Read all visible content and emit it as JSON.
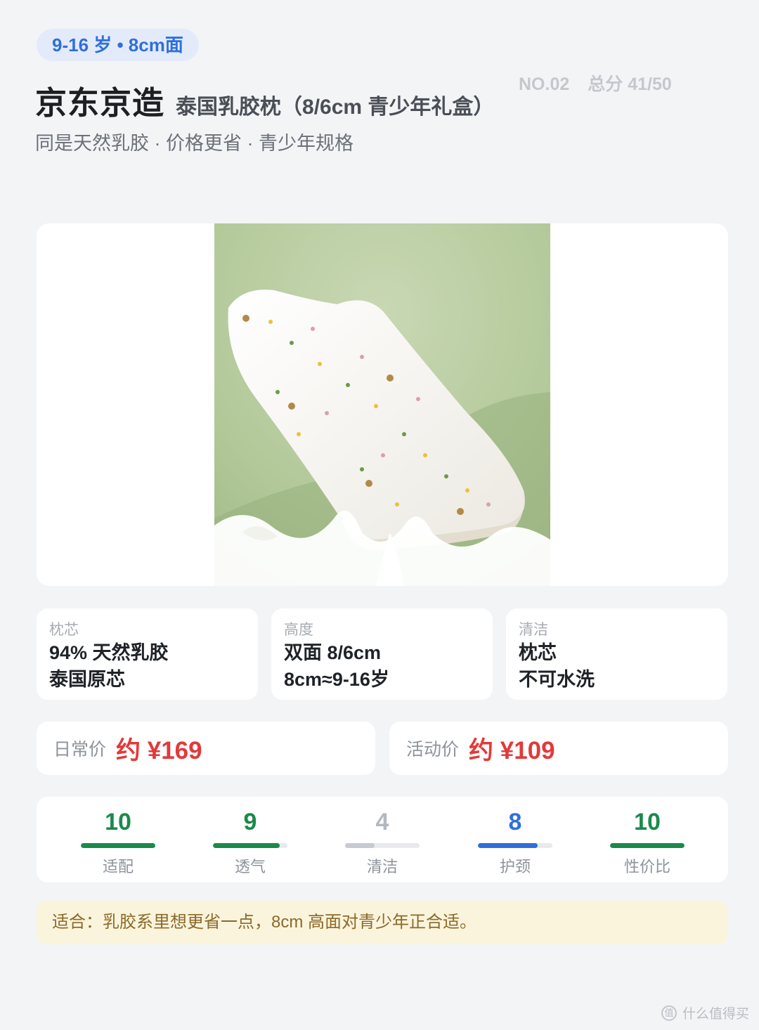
{
  "header": {
    "badge": "9-16 岁 • 8cm面",
    "brand": "京东京造",
    "product": "泰国乳胶枕（8/6cm 青少年礼盒）",
    "rank": "NO.02",
    "total_score": "总分 41/50",
    "subtitle": "同是天然乳胶 · 价格更省 · 青少年规格"
  },
  "specs": [
    {
      "label": "枕芯",
      "line1": "94% 天然乳胶",
      "line2": "泰国原芯"
    },
    {
      "label": "高度",
      "line1": "双面 8/6cm",
      "line2": "8cm≈9-16岁"
    },
    {
      "label": "清洁",
      "line1": "枕芯",
      "line2": "不可水洗"
    }
  ],
  "prices": {
    "daily_label": "日常价",
    "daily_value": "约 ¥169",
    "promo_label": "活动价",
    "promo_value": "约 ¥109"
  },
  "scores": [
    {
      "name": "适配",
      "value": "10",
      "fraction": 1.0,
      "color": "#1a8a4a"
    },
    {
      "name": "透气",
      "value": "9",
      "fraction": 0.9,
      "color": "#1a8a4a"
    },
    {
      "name": "清洁",
      "value": "4",
      "fraction": 0.4,
      "color": "#c6cad1"
    },
    {
      "name": "护颈",
      "value": "8",
      "fraction": 0.8,
      "color": "#2f6fdc"
    },
    {
      "name": "性价比",
      "value": "10",
      "fraction": 1.0,
      "color": "#1a8a4a"
    }
  ],
  "note": "适合：乳胶系里想更省一点，8cm 高面对青少年正合适。",
  "watermark": "什么值得买",
  "watermark_icon": "值"
}
